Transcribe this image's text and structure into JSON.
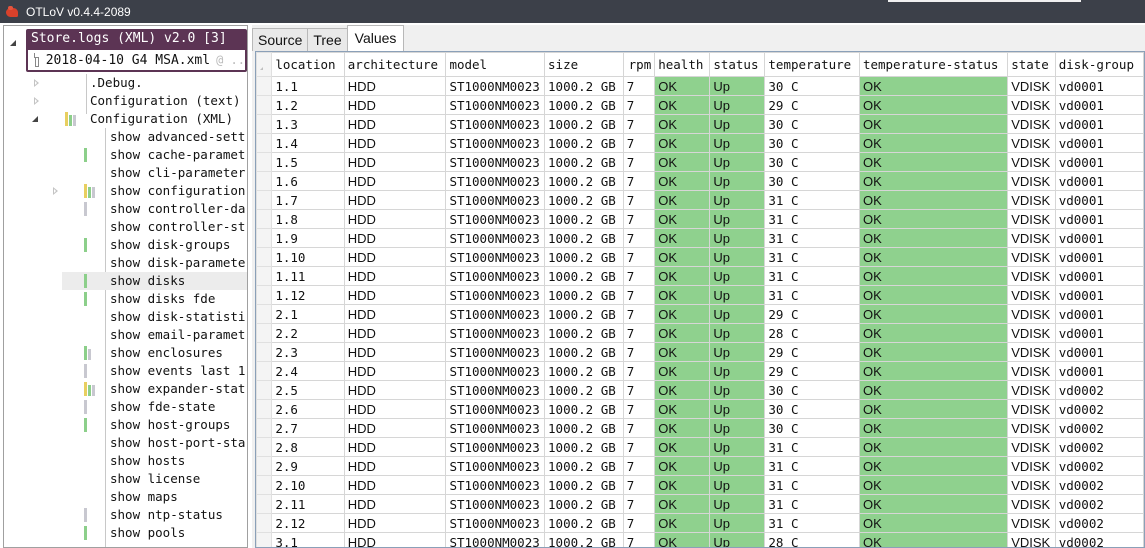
{
  "window": {
    "title": "OTLoV v0.4.4-2089"
  },
  "store": {
    "title": "Store.logs (XML) v2.0 [3]",
    "file": "2018-04-10 G4 MSA.xml",
    "file_suffix": "@ .."
  },
  "tree": {
    "items": [
      {
        "label": ".Debug.",
        "expander": "collapsed",
        "bars": []
      },
      {
        "label": "Configuration (text)",
        "expander": "collapsed",
        "bars": []
      },
      {
        "label": "Configuration (XML)",
        "expander": "expanded",
        "bars": [
          "yellow",
          "green",
          "gray"
        ]
      },
      {
        "label": "show advanced-sett",
        "bars": []
      },
      {
        "label": "show cache-paramet",
        "bars": [
          "green"
        ]
      },
      {
        "label": "show cli-parameter",
        "bars": []
      },
      {
        "label": "show configuration",
        "expander": "collapsed",
        "bars": [
          "yellow",
          "green",
          "gray"
        ]
      },
      {
        "label": "show controller-da",
        "bars": [
          "gray"
        ]
      },
      {
        "label": "show controller-st",
        "bars": []
      },
      {
        "label": "show disk-groups",
        "bars": [
          "green"
        ]
      },
      {
        "label": "show disk-paramete",
        "bars": []
      },
      {
        "label": "show disks",
        "bars": [
          "green"
        ],
        "selected": true
      },
      {
        "label": "show disks fde",
        "bars": [
          "green"
        ]
      },
      {
        "label": "show disk-statisti",
        "bars": []
      },
      {
        "label": "show email-paramet",
        "bars": []
      },
      {
        "label": "show enclosures",
        "bars": [
          "green",
          "gray"
        ]
      },
      {
        "label": "show events last 1",
        "bars": [
          "gray"
        ]
      },
      {
        "label": "show expander-stat",
        "bars": [
          "yellow",
          "green",
          "gray"
        ]
      },
      {
        "label": "show fde-state",
        "bars": [
          "gray"
        ]
      },
      {
        "label": "show host-groups",
        "bars": [
          "green"
        ]
      },
      {
        "label": "show host-port-sta",
        "bars": []
      },
      {
        "label": "show hosts",
        "bars": []
      },
      {
        "label": "show license",
        "bars": []
      },
      {
        "label": "show maps",
        "bars": []
      },
      {
        "label": "show ntp-status",
        "bars": [
          "gray"
        ]
      },
      {
        "label": "show pools",
        "bars": [
          "green"
        ]
      }
    ]
  },
  "tabs": [
    {
      "label": "Source",
      "active": false
    },
    {
      "label": "Tree",
      "active": false
    },
    {
      "label": "Values",
      "active": true
    }
  ],
  "colors": {
    "ok_green": "#8fd18e",
    "bar_green": "#8ccf8a",
    "bar_yellow": "#e8cf60",
    "bar_gray": "#c8c8d0",
    "store_header": "#5c3454",
    "titlebar": "#3c4049"
  },
  "table": {
    "columns": [
      "location",
      "architecture",
      "model",
      "size",
      "rpm",
      "health",
      "status",
      "temperature",
      "temperature-status",
      "state",
      "disk-group"
    ],
    "rows": [
      [
        "1.1",
        "HDD",
        "ST1000NM0023",
        "1000.2 GB",
        "7",
        "OK",
        "Up",
        "30 C",
        "OK",
        "VDISK",
        "vd0001"
      ],
      [
        "1.2",
        "HDD",
        "ST1000NM0023",
        "1000.2 GB",
        "7",
        "OK",
        "Up",
        "29 C",
        "OK",
        "VDISK",
        "vd0001"
      ],
      [
        "1.3",
        "HDD",
        "ST1000NM0023",
        "1000.2 GB",
        "7",
        "OK",
        "Up",
        "30 C",
        "OK",
        "VDISK",
        "vd0001"
      ],
      [
        "1.4",
        "HDD",
        "ST1000NM0023",
        "1000.2 GB",
        "7",
        "OK",
        "Up",
        "30 C",
        "OK",
        "VDISK",
        "vd0001"
      ],
      [
        "1.5",
        "HDD",
        "ST1000NM0023",
        "1000.2 GB",
        "7",
        "OK",
        "Up",
        "30 C",
        "OK",
        "VDISK",
        "vd0001"
      ],
      [
        "1.6",
        "HDD",
        "ST1000NM0023",
        "1000.2 GB",
        "7",
        "OK",
        "Up",
        "30 C",
        "OK",
        "VDISK",
        "vd0001"
      ],
      [
        "1.7",
        "HDD",
        "ST1000NM0023",
        "1000.2 GB",
        "7",
        "OK",
        "Up",
        "31 C",
        "OK",
        "VDISK",
        "vd0001"
      ],
      [
        "1.8",
        "HDD",
        "ST1000NM0023",
        "1000.2 GB",
        "7",
        "OK",
        "Up",
        "31 C",
        "OK",
        "VDISK",
        "vd0001"
      ],
      [
        "1.9",
        "HDD",
        "ST1000NM0023",
        "1000.2 GB",
        "7",
        "OK",
        "Up",
        "31 C",
        "OK",
        "VDISK",
        "vd0001"
      ],
      [
        "1.10",
        "HDD",
        "ST1000NM0023",
        "1000.2 GB",
        "7",
        "OK",
        "Up",
        "31 C",
        "OK",
        "VDISK",
        "vd0001"
      ],
      [
        "1.11",
        "HDD",
        "ST1000NM0023",
        "1000.2 GB",
        "7",
        "OK",
        "Up",
        "31 C",
        "OK",
        "VDISK",
        "vd0001"
      ],
      [
        "1.12",
        "HDD",
        "ST1000NM0023",
        "1000.2 GB",
        "7",
        "OK",
        "Up",
        "31 C",
        "OK",
        "VDISK",
        "vd0001"
      ],
      [
        "2.1",
        "HDD",
        "ST1000NM0023",
        "1000.2 GB",
        "7",
        "OK",
        "Up",
        "29 C",
        "OK",
        "VDISK",
        "vd0001"
      ],
      [
        "2.2",
        "HDD",
        "ST1000NM0023",
        "1000.2 GB",
        "7",
        "OK",
        "Up",
        "28 C",
        "OK",
        "VDISK",
        "vd0001"
      ],
      [
        "2.3",
        "HDD",
        "ST1000NM0023",
        "1000.2 GB",
        "7",
        "OK",
        "Up",
        "29 C",
        "OK",
        "VDISK",
        "vd0001"
      ],
      [
        "2.4",
        "HDD",
        "ST1000NM0023",
        "1000.2 GB",
        "7",
        "OK",
        "Up",
        "29 C",
        "OK",
        "VDISK",
        "vd0001"
      ],
      [
        "2.5",
        "HDD",
        "ST1000NM0023",
        "1000.2 GB",
        "7",
        "OK",
        "Up",
        "30 C",
        "OK",
        "VDISK",
        "vd0002"
      ],
      [
        "2.6",
        "HDD",
        "ST1000NM0023",
        "1000.2 GB",
        "7",
        "OK",
        "Up",
        "30 C",
        "OK",
        "VDISK",
        "vd0002"
      ],
      [
        "2.7",
        "HDD",
        "ST1000NM0023",
        "1000.2 GB",
        "7",
        "OK",
        "Up",
        "30 C",
        "OK",
        "VDISK",
        "vd0002"
      ],
      [
        "2.8",
        "HDD",
        "ST1000NM0023",
        "1000.2 GB",
        "7",
        "OK",
        "Up",
        "31 C",
        "OK",
        "VDISK",
        "vd0002"
      ],
      [
        "2.9",
        "HDD",
        "ST1000NM0023",
        "1000.2 GB",
        "7",
        "OK",
        "Up",
        "31 C",
        "OK",
        "VDISK",
        "vd0002"
      ],
      [
        "2.10",
        "HDD",
        "ST1000NM0023",
        "1000.2 GB",
        "7",
        "OK",
        "Up",
        "31 C",
        "OK",
        "VDISK",
        "vd0002"
      ],
      [
        "2.11",
        "HDD",
        "ST1000NM0023",
        "1000.2 GB",
        "7",
        "OK",
        "Up",
        "31 C",
        "OK",
        "VDISK",
        "vd0002"
      ],
      [
        "2.12",
        "HDD",
        "ST1000NM0023",
        "1000.2 GB",
        "7",
        "OK",
        "Up",
        "31 C",
        "OK",
        "VDISK",
        "vd0002"
      ],
      [
        "3.1",
        "HDD",
        "ST1000NM0023",
        "1000.2 GB",
        "7",
        "OK",
        "Up",
        "28 C",
        "OK",
        "VDISK",
        "vd0002"
      ]
    ]
  }
}
